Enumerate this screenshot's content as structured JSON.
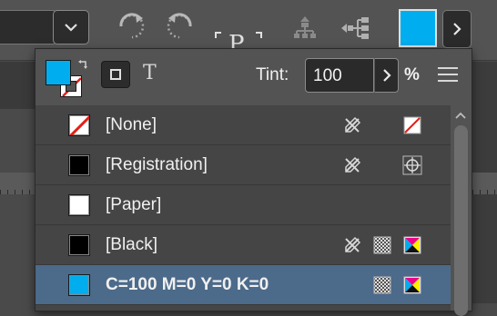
{
  "toolbar": {
    "zoom_field_value": "",
    "swatch_color": "#00aeef",
    "icons": [
      "chevron-down-icon",
      "rotate-clockwise-icon",
      "rotate-counterclockwise-icon",
      "text-frame-icon",
      "hierarchy-icon",
      "hierarchy-left-icon",
      "chevron-right-icon"
    ],
    "frame_letter": "P"
  },
  "panel": {
    "fill_color": "#00aeef",
    "stroke_color": "#ffffff",
    "text_mode_glyph": "T",
    "tint_label": "Tint:",
    "tint_value": "100",
    "percent_label": "%"
  },
  "swatches": [
    {
      "name": "[None]",
      "chip": "none",
      "icons": [
        "pencil-crossed-icon",
        "none-swatch-icon"
      ]
    },
    {
      "name": "[Registration]",
      "chip": "#000000",
      "icons": [
        "pencil-crossed-icon",
        "registration-icon"
      ]
    },
    {
      "name": "[Paper]",
      "chip": "#ffffff",
      "icons": []
    },
    {
      "name": "[Black]",
      "chip": "#000000",
      "icons": [
        "pencil-crossed-icon",
        "process-color-icon",
        "cmyk-icon"
      ]
    },
    {
      "name": "C=100 M=0 Y=0 K=0",
      "chip": "#00aeef",
      "icons": [
        "process-color-icon",
        "cmyk-icon"
      ],
      "selected": true
    }
  ],
  "colors": {
    "accent": "#00aeef",
    "selection": "#4c6a8a",
    "panel_bg": "#535353"
  }
}
